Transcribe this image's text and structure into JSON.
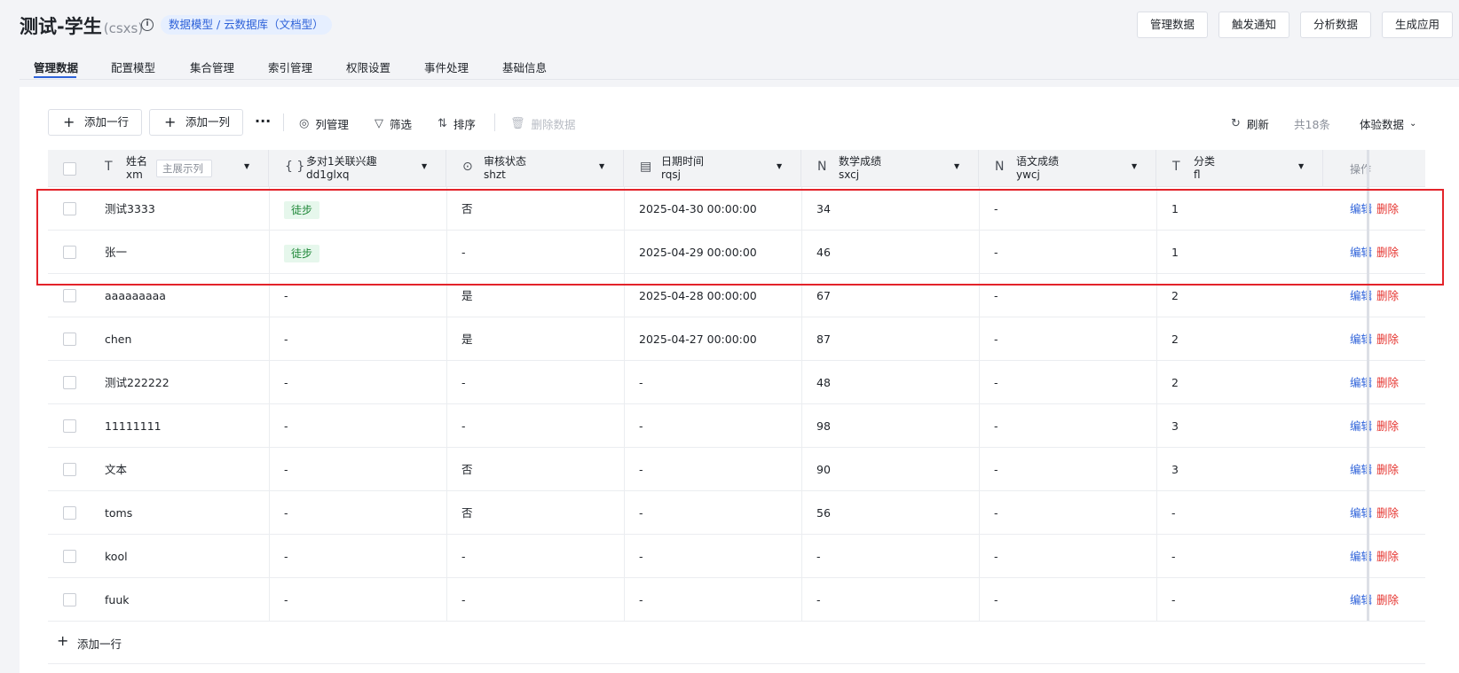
{
  "header": {
    "title": "测试-学生",
    "title_code": "(csxs)",
    "breadcrumb": "数据模型 / 云数据库（文档型）",
    "buttons": [
      "管理数据",
      "触发通知",
      "分析数据",
      "生成应用"
    ]
  },
  "tabs": [
    "管理数据",
    "配置模型",
    "集合管理",
    "索引管理",
    "权限设置",
    "事件处理",
    "基础信息"
  ],
  "toolbar": {
    "add_row": "添加一行",
    "add_col": "添加一列",
    "more": "···",
    "col_manage": "列管理",
    "filter": "筛选",
    "sort": "排序",
    "delete": "删除数据",
    "refresh": "刷新",
    "total": "共18条",
    "env": "体验数据"
  },
  "columns": [
    {
      "name": "姓名",
      "code": "xm",
      "icon": "T",
      "extra": "主展示列"
    },
    {
      "name": "多对1关联兴趣",
      "code": "dd1glxq",
      "icon": "{ }"
    },
    {
      "name": "审核状态",
      "code": "shzt",
      "icon": "⊙"
    },
    {
      "name": "日期时间",
      "code": "rqsj",
      "icon": "▤"
    },
    {
      "name": "数学成绩",
      "code": "sxcj",
      "icon": "N"
    },
    {
      "name": "语文成绩",
      "code": "ywcj",
      "icon": "N"
    },
    {
      "name": "分类",
      "code": "fl",
      "icon": "T"
    }
  ],
  "op_header": "操作",
  "actions": {
    "edit": "编辑",
    "del": "删除"
  },
  "rows": [
    {
      "name": "测试3333",
      "interest": "徒步",
      "interest_tag": true,
      "status": "否",
      "date": "2025-04-30 00:00:00",
      "math": "34",
      "chinese": "-",
      "cat": "1"
    },
    {
      "name": "张一",
      "interest": "徒步",
      "interest_tag": true,
      "status": "-",
      "date": "2025-04-29 00:00:00",
      "math": "46",
      "chinese": "-",
      "cat": "1"
    },
    {
      "name": "aaaaaaaaa",
      "interest": "-",
      "interest_tag": false,
      "status": "是",
      "date": "2025-04-28 00:00:00",
      "math": "67",
      "chinese": "-",
      "cat": "2"
    },
    {
      "name": "chen",
      "interest": "-",
      "interest_tag": false,
      "status": "是",
      "date": "2025-04-27 00:00:00",
      "math": "87",
      "chinese": "-",
      "cat": "2"
    },
    {
      "name": "测试222222",
      "interest": "-",
      "interest_tag": false,
      "status": "-",
      "date": "-",
      "math": "48",
      "chinese": "-",
      "cat": "2"
    },
    {
      "name": "11111111",
      "interest": "-",
      "interest_tag": false,
      "status": "-",
      "date": "-",
      "math": "98",
      "chinese": "-",
      "cat": "3"
    },
    {
      "name": "文本",
      "interest": "-",
      "interest_tag": false,
      "status": "否",
      "date": "-",
      "math": "90",
      "chinese": "-",
      "cat": "3"
    },
    {
      "name": "toms",
      "interest": "-",
      "interest_tag": false,
      "status": "否",
      "date": "-",
      "math": "56",
      "chinese": "-",
      "cat": "-"
    },
    {
      "name": "kool",
      "interest": "-",
      "interest_tag": false,
      "status": "-",
      "date": "-",
      "math": "-",
      "chinese": "-",
      "cat": "-"
    },
    {
      "name": "fuuk",
      "interest": "-",
      "interest_tag": false,
      "status": "-",
      "date": "-",
      "math": "-",
      "chinese": "-",
      "cat": "-"
    }
  ],
  "add_row_footer": "添加一行",
  "colors": {
    "accent": "#2e62d9",
    "danger": "#e5332e",
    "tag_green": "#21883a",
    "highlight": "#e3232a"
  }
}
